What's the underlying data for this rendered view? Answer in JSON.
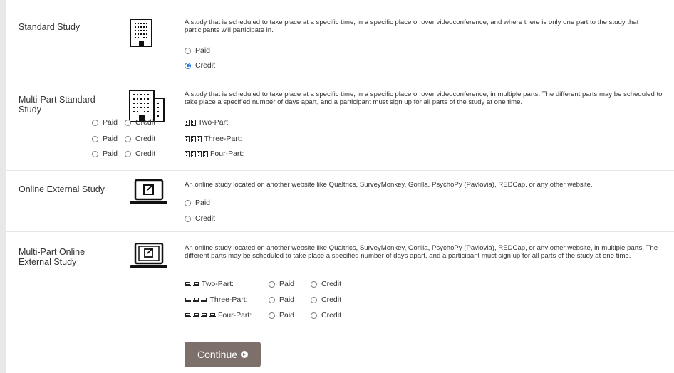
{
  "study_types": [
    {
      "label": "Standard Study",
      "icon": "building-icon",
      "description": "A study that is scheduled to take place at a specific time, in a specific place or over videoconference, and where there is only one part to the study that participants will participate in.",
      "options": [
        {
          "label": "Paid",
          "checked": false
        },
        {
          "label": "Credit",
          "checked": true
        }
      ]
    },
    {
      "label": "Multi-Part Standard Study",
      "icon": "buildings-icon",
      "description": "A study that is scheduled to take place at a specific time, in a specific place or over videoconference, in multiple parts. The different parts may be scheduled to take place a specified number of days apart, and a participant must sign up for all parts of the study at one time.",
      "parts": [
        {
          "label": "Two-Part:",
          "count": 2,
          "paid": "Paid",
          "credit": "Credit"
        },
        {
          "label": "Three-Part:",
          "count": 3,
          "paid": "Paid",
          "credit": "Credit"
        },
        {
          "label": "Four-Part:",
          "count": 4,
          "paid": "Paid",
          "credit": "Credit"
        }
      ]
    },
    {
      "label": "Online External Study",
      "icon": "laptop-external-link-icon",
      "description": "An online study located on another website like Qualtrics, SurveyMonkey, Gorilla, PsychoPy (Pavlovia), REDCap, or any other website.",
      "options": [
        {
          "label": "Paid",
          "checked": false
        },
        {
          "label": "Credit",
          "checked": false
        }
      ]
    },
    {
      "label": "Multi-Part Online External Study",
      "icon": "laptops-external-link-icon",
      "description": "An online study located on another website like Qualtrics, SurveyMonkey, Gorilla, PsychoPy (Pavlovia), REDCap, or any other website, in multiple parts. The different parts may be scheduled to take place a specified number of days apart, and a participant must sign up for all parts of the study at one time.",
      "parts": [
        {
          "label": "Two-Part:",
          "count": 2,
          "paid": "Paid",
          "credit": "Credit"
        },
        {
          "label": "Three-Part:",
          "count": 3,
          "paid": "Paid",
          "credit": "Credit"
        },
        {
          "label": "Four-Part:",
          "count": 4,
          "paid": "Paid",
          "credit": "Credit"
        }
      ]
    }
  ],
  "continue_label": "Continue",
  "colors": {
    "button_bg": "#7d6f6a",
    "radio_checked": "#1a73e8",
    "divider": "#e6e6e6"
  }
}
